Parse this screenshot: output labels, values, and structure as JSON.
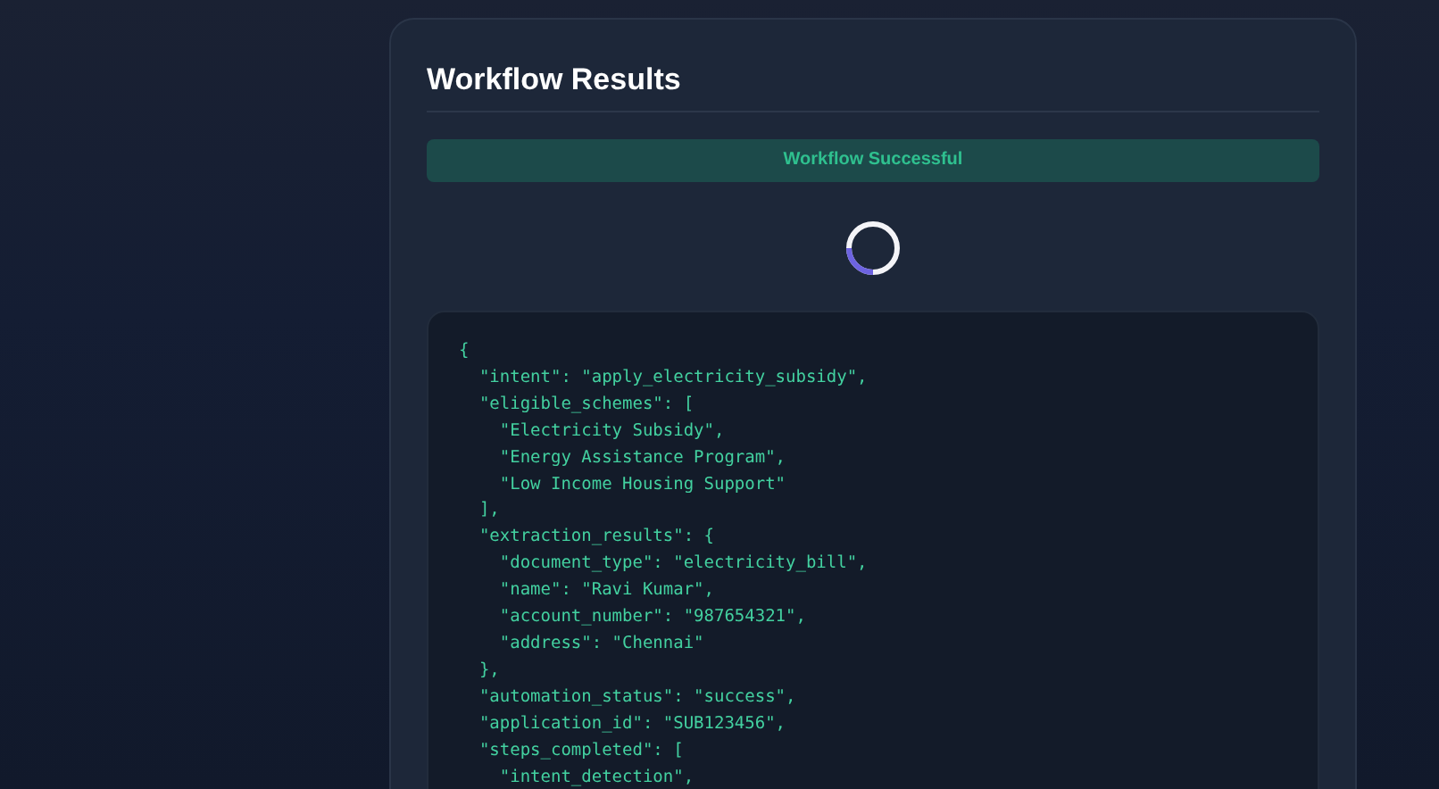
{
  "card": {
    "title": "Workflow Results",
    "status_banner": "Workflow Successful"
  },
  "code_block": {
    "lines": [
      "{",
      "  \"intent\": \"apply_electricity_subsidy\",",
      "  \"eligible_schemes\": [",
      "    \"Electricity Subsidy\",",
      "    \"Energy Assistance Program\",",
      "    \"Low Income Housing Support\"",
      "  ],",
      "  \"extraction_results\": {",
      "    \"document_type\": \"electricity_bill\",",
      "    \"name\": \"Ravi Kumar\",",
      "    \"account_number\": \"987654321\",",
      "    \"address\": \"Chennai\"",
      "  },",
      "  \"automation_status\": \"success\",",
      "  \"application_id\": \"SUB123456\",",
      "  \"steps_completed\": [",
      "    \"intent_detection\","
    ]
  }
}
